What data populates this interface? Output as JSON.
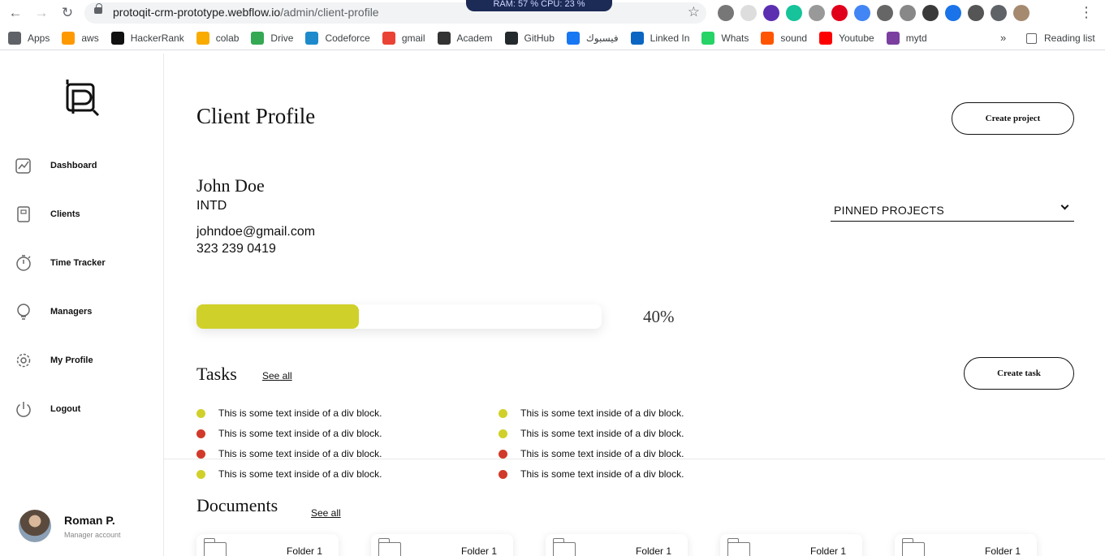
{
  "browser": {
    "url_host": "protoqit-crm-prototype.webflow.io",
    "url_path": "/admin/client-profile",
    "ram_cpu": "RAM: 57 %  CPU: 23 %",
    "bookmarks": [
      {
        "label": "Apps",
        "color": "#5f6368"
      },
      {
        "label": "aws",
        "color": "#ff9900"
      },
      {
        "label": "HackerRank",
        "color": "#111111"
      },
      {
        "label": "colab",
        "color": "#f9ab00"
      },
      {
        "label": "Drive",
        "color": "#34a853"
      },
      {
        "label": "Codeforce",
        "color": "#1f8acb"
      },
      {
        "label": "gmail",
        "color": "#ea4335"
      },
      {
        "label": "Academ",
        "color": "#333333"
      },
      {
        "label": "GitHub",
        "color": "#24292e"
      },
      {
        "label": "فيسبوك",
        "color": "#1877f2"
      },
      {
        "label": "Linked In",
        "color": "#0a66c2"
      },
      {
        "label": "Whats",
        "color": "#25d366"
      },
      {
        "label": "sound",
        "color": "#ff5500"
      },
      {
        "label": "Youtube",
        "color": "#ff0000"
      },
      {
        "label": "mytd",
        "color": "#7b3fa0"
      }
    ],
    "bookmarks_more": "»",
    "reading_list": "Reading list"
  },
  "sidebar": {
    "items": [
      {
        "label": "Dashboard",
        "icon": "chart-icon"
      },
      {
        "label": "Clients",
        "icon": "notebook-icon"
      },
      {
        "label": "Time Tracker",
        "icon": "stopwatch-icon"
      },
      {
        "label": "Managers",
        "icon": "lightbulb-icon"
      },
      {
        "label": "My Profile",
        "icon": "gear-icon"
      },
      {
        "label": "Logout",
        "icon": "power-icon"
      }
    ],
    "user": {
      "name": "Roman P.",
      "role": "Manager account"
    }
  },
  "main": {
    "title": "Client Profile",
    "create_project_label": "Create project",
    "client": {
      "name": "John Doe",
      "company": "INTD",
      "email": "johndoe@gmail.com",
      "phone": "323 239 0419"
    },
    "pinned_projects_label": "PINNED PROJECTS",
    "progress": {
      "value": 40,
      "label": "40%"
    },
    "tasks": {
      "title": "Tasks",
      "see_all": "See all",
      "create_task_label": "Create task",
      "items": [
        {
          "text": "This is some text inside of a div block.",
          "status": "yellow"
        },
        {
          "text": "This is some text inside of a div block.",
          "status": "red"
        },
        {
          "text": "This is some text inside of a div block.",
          "status": "red"
        },
        {
          "text": "This is some text inside of a div block.",
          "status": "yellow"
        },
        {
          "text": "This is some text inside of a div block.",
          "status": "yellow"
        },
        {
          "text": "This is some text inside of a div block.",
          "status": "yellow"
        },
        {
          "text": "This is some text inside of a div block.",
          "status": "red"
        },
        {
          "text": "This is some text inside of a div block.",
          "status": "red"
        }
      ]
    },
    "documents": {
      "title": "Documents",
      "see_all": "See all",
      "folders": [
        "Folder 1",
        "Folder 1",
        "Folder 1",
        "Folder 1",
        "Folder 1"
      ]
    }
  },
  "colors": {
    "accent_yellow": "#d0d02a",
    "status_red": "#d13a2a",
    "status_yellow": "#d0d02a"
  }
}
